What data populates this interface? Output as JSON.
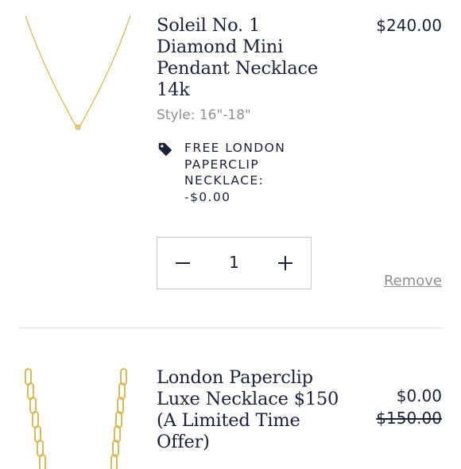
{
  "items": [
    {
      "title": "Soleil No. 1 Diamond Mini Pendant Necklace 14k",
      "price": "$240.00",
      "style": "Style: 16\"-18\"",
      "promo_icon": "tag-icon",
      "promo": "FREE LONDON PAPERCLIP NECKLACE: -$0.00",
      "quantity": "1",
      "remove_label": "Remove"
    },
    {
      "title": "London Paperclip Luxe Necklace $150 (A Limited Time Offer)",
      "price": "$0.00",
      "original_price": "$150.00"
    }
  ],
  "icons": {
    "decrease": "minus-icon",
    "increase": "plus-icon"
  },
  "colors": {
    "text": "#1b2238",
    "muted": "#8f8f96",
    "gold": "#d9b95a",
    "divider": "#e3e3e6"
  }
}
